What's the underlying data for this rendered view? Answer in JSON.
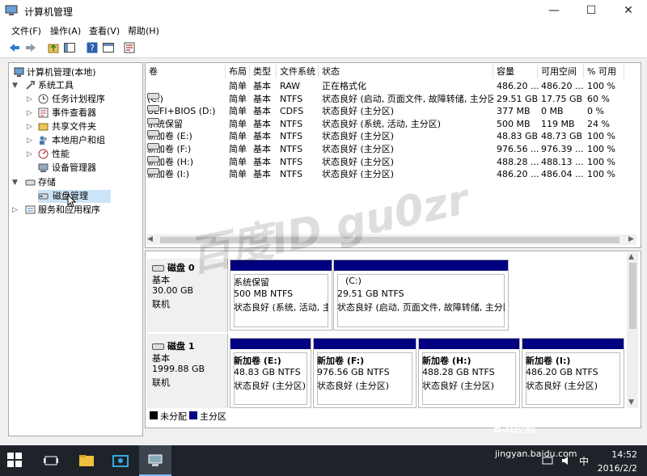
{
  "window": {
    "title": "计算机管理",
    "minimize": "—",
    "maximize": "☐",
    "close": "✕"
  },
  "menu": [
    "文件(F)",
    "操作(A)",
    "查看(V)",
    "帮助(H)"
  ],
  "tree": {
    "root": "计算机管理(本地)",
    "system_tools": "系统工具",
    "task_scheduler": "任务计划程序",
    "event_viewer": "事件查看器",
    "shared_folders": "共享文件夹",
    "local_users": "本地用户和组",
    "performance": "性能",
    "device_manager": "设备管理器",
    "storage": "存储",
    "disk_management": "磁盘管理",
    "services_apps": "服务和应用程序"
  },
  "columns": [
    "卷",
    "布局",
    "类型",
    "文件系统",
    "状态",
    "容量",
    "可用空间",
    "% 可用"
  ],
  "volumes": [
    {
      "name": "",
      "layout": "简单",
      "type": "基本",
      "fs": "RAW",
      "status": "正在格式化",
      "cap": "486.20 ...",
      "free": "486.20 ...",
      "pct": "100 %"
    },
    {
      "name": "(C:)",
      "layout": "简单",
      "type": "基本",
      "fs": "NTFS",
      "status": "状态良好 (启动, 页面文件, 故障转储, 主分区)",
      "cap": "29.51 GB",
      "free": "17.75 GB",
      "pct": "60 %"
    },
    {
      "name": "UEFI+BIOS (D:)",
      "layout": "简单",
      "type": "基本",
      "fs": "CDFS",
      "status": "状态良好 (主分区)",
      "cap": "377 MB",
      "free": "0 MB",
      "pct": "0 %"
    },
    {
      "name": "系统保留",
      "layout": "简单",
      "type": "基本",
      "fs": "NTFS",
      "status": "状态良好 (系统, 活动, 主分区)",
      "cap": "500 MB",
      "free": "119 MB",
      "pct": "24 %"
    },
    {
      "name": "新加卷 (E:)",
      "layout": "简单",
      "type": "基本",
      "fs": "NTFS",
      "status": "状态良好 (主分区)",
      "cap": "48.83 GB",
      "free": "48.73 GB",
      "pct": "100 %"
    },
    {
      "name": "新加卷 (F:)",
      "layout": "简单",
      "type": "基本",
      "fs": "NTFS",
      "status": "状态良好 (主分区)",
      "cap": "976.56 ...",
      "free": "976.39 ...",
      "pct": "100 %"
    },
    {
      "name": "新加卷 (H:)",
      "layout": "简单",
      "type": "基本",
      "fs": "NTFS",
      "status": "状态良好 (主分区)",
      "cap": "488.28 ...",
      "free": "488.13 ...",
      "pct": "100 %"
    },
    {
      "name": "新加卷 (I:)",
      "layout": "简单",
      "type": "基本",
      "fs": "NTFS",
      "status": "状态良好 (主分区)",
      "cap": "486.20 ...",
      "free": "486.04 ...",
      "pct": "100 %"
    }
  ],
  "disk0": {
    "name": "磁盘 0",
    "kind": "基本",
    "size": "30.00 GB",
    "state": "联机",
    "parts": [
      {
        "name": "系统保留",
        "size": "500 MB NTFS",
        "status": "状态良好 (系统, 活动, 主"
      },
      {
        "name": "(C:)",
        "size": "29.51 GB NTFS",
        "status": "状态良好 (启动, 页面文件, 故障转储, 主分区"
      }
    ]
  },
  "disk1": {
    "name": "磁盘 1",
    "kind": "基本",
    "size": "1999.88 GB",
    "state": "联机",
    "parts": [
      {
        "name": "新加卷 (E:)",
        "size": "48.83 GB NTFS",
        "status": "状态良好 (主分区)"
      },
      {
        "name": "新加卷 (F:)",
        "size": "976.56 GB NTFS",
        "status": "状态良好 (主分区)"
      },
      {
        "name": "新加卷 (H:)",
        "size": "488.28 GB NTFS",
        "status": "状态良好 (主分区)"
      },
      {
        "name": "新加卷 (I:)",
        "size": "486.20 GB NTFS",
        "status": "状态良好 (主分区)"
      }
    ]
  },
  "legend": {
    "unallocated": "未分配",
    "primary": "主分区"
  },
  "taskbar": {
    "time": "14:52",
    "date": "2016/2/2",
    "ime": "中"
  },
  "watermark": {
    "main": "百度ID gu0zr",
    "brand": "Bai经验",
    "url": "jingyan.baidu.com"
  },
  "colors": {
    "partition_bar": "#000080",
    "taskbar": "#1e2329"
  }
}
